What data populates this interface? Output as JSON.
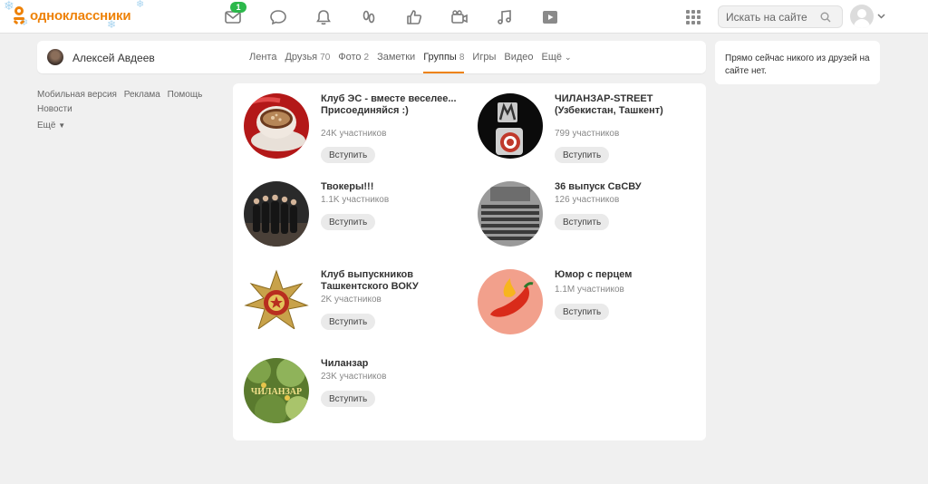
{
  "header": {
    "logo_text": "одноклассники",
    "notifications_badge": "1",
    "search_placeholder": "Искать на сайте",
    "icons": [
      "mail-icon",
      "chat-icon",
      "bell-icon",
      "guests-icon",
      "like-icon",
      "video-camera-icon",
      "music-icon",
      "video-play-icon"
    ]
  },
  "profile": {
    "name": "Алексей Авдеев",
    "tabs": [
      {
        "label": "Лента",
        "count": ""
      },
      {
        "label": "Друзья",
        "count": "70"
      },
      {
        "label": "Фото",
        "count": "2"
      },
      {
        "label": "Заметки",
        "count": ""
      },
      {
        "label": "Группы",
        "count": "8"
      },
      {
        "label": "Игры",
        "count": ""
      },
      {
        "label": "Видео",
        "count": ""
      },
      {
        "label": "Ещё",
        "count": ""
      }
    ],
    "active_tab": "Группы"
  },
  "left_links": {
    "mobile": "Мобильная версия",
    "ads": "Реклама",
    "help": "Помощь",
    "news": "Новости",
    "more": "Ещё"
  },
  "right_panel": {
    "text": "Прямо сейчас никого из друзей на сайте нет."
  },
  "groups": [
    {
      "name": "Клуб ЭС - вместе веселее... Присоединяйся :)",
      "members": "24K участников",
      "join": "Вступить"
    },
    {
      "name": "ЧИЛАНЗАР-STREET (Узбекистан, Ташкент)",
      "members": "799 участников",
      "join": "Вступить"
    },
    {
      "name": "Твокеры!!!",
      "members": "1.1K участников",
      "join": "Вступить"
    },
    {
      "name": "36 выпуск СвСВУ",
      "members": "126 участников",
      "join": "Вступить"
    },
    {
      "name": "Клуб выпускников Ташкентского ВОКУ",
      "members": "2K участников",
      "join": "Вступить"
    },
    {
      "name": "Юмор с перцем",
      "members": "1.1M участников",
      "join": "Вступить"
    },
    {
      "name": "Чиланзар",
      "members": "23K участников",
      "join": "Вступить"
    }
  ],
  "group_image_texts": {
    "chilanzar": "ЧИЛАНЗАР"
  },
  "colors": {
    "brand": "#ee8208",
    "badge": "#2cb84b",
    "background": "#f0f0f0"
  }
}
